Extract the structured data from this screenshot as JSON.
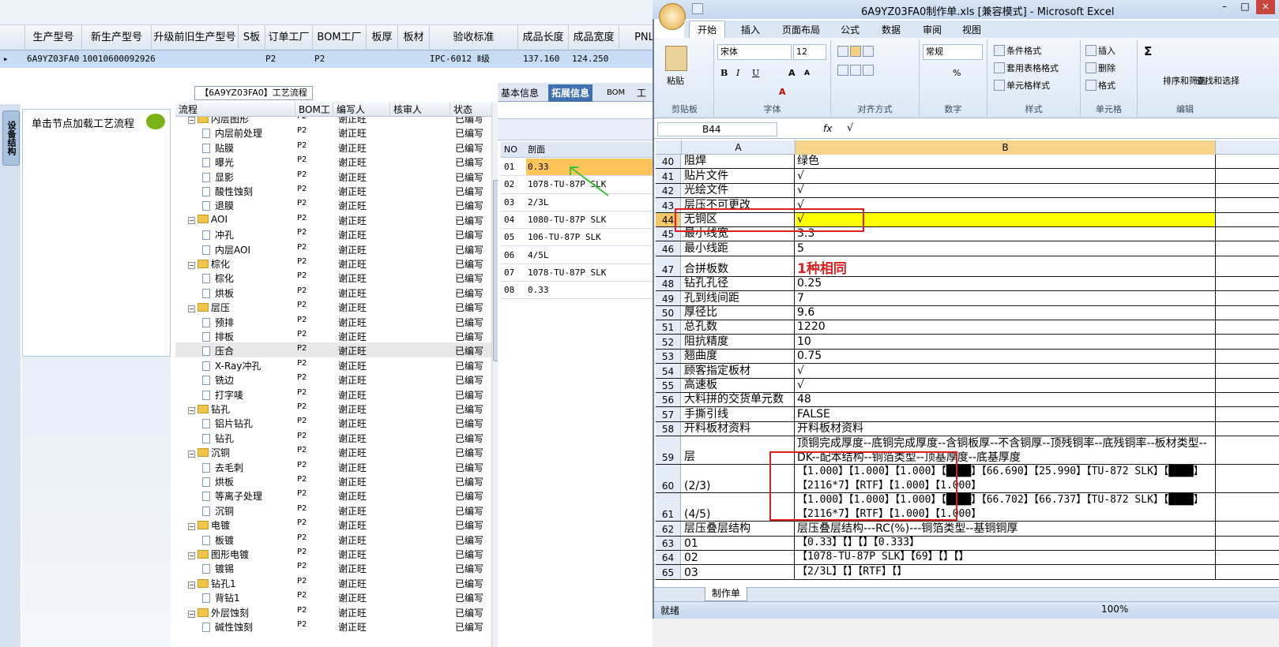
{
  "left_app": {
    "grid": {
      "headers": [
        "生产型号",
        "新生产型号",
        "升级前旧生产型号",
        "S板",
        "订单工厂",
        "BOM工厂",
        "板厚",
        "板材",
        "验收标准",
        "成品长度",
        "成品宽度",
        "PNL规"
      ],
      "row": {
        "marker": "▸",
        "model": "6A9YZ03FA0",
        "new_model": "10010600092926",
        "order_factory": "P2",
        "bom_factory": "P2",
        "standard": "IPC-6012 Ⅱ级",
        "length": "137.160",
        "width": "124.250"
      }
    },
    "flow_title": "【6A9YZ03FA0】工艺流程",
    "rail_tab": "设备结构",
    "node_hint": "单击节点加载工艺流程",
    "tree": {
      "headers": [
        "流程",
        "BOM工厂",
        "编写人",
        "核审人",
        "状态"
      ],
      "rows": [
        {
          "name": "内层图形",
          "level": 0,
          "folder": true
        },
        {
          "name": "内层前处理",
          "level": 1
        },
        {
          "name": "贴膜",
          "level": 1
        },
        {
          "name": "曝光",
          "level": 1
        },
        {
          "name": "显影",
          "level": 1
        },
        {
          "name": "酸性蚀刻",
          "level": 1
        },
        {
          "name": "退膜",
          "level": 1
        },
        {
          "name": "AOI",
          "level": 0,
          "folder": true
        },
        {
          "name": "冲孔",
          "level": 1
        },
        {
          "name": "内层AOI",
          "level": 1
        },
        {
          "name": "棕化",
          "level": 0,
          "folder": true
        },
        {
          "name": "棕化",
          "level": 1
        },
        {
          "name": "烘板",
          "level": 1
        },
        {
          "name": "层压",
          "level": 0,
          "folder": true
        },
        {
          "name": "预排",
          "level": 1
        },
        {
          "name": "排板",
          "level": 1
        },
        {
          "name": "压合",
          "level": 1,
          "selected": true
        },
        {
          "name": "X-Ray冲孔",
          "level": 1
        },
        {
          "name": "铣边",
          "level": 1
        },
        {
          "name": "打字唛",
          "level": 1
        },
        {
          "name": "钻孔",
          "level": 0,
          "folder": true
        },
        {
          "name": "铝片钻孔",
          "level": 1
        },
        {
          "name": "钻孔",
          "level": 1
        },
        {
          "name": "沉铜",
          "level": 0,
          "folder": true
        },
        {
          "name": "去毛刺",
          "level": 1
        },
        {
          "name": "烘板",
          "level": 1
        },
        {
          "name": "等离子处理",
          "level": 1
        },
        {
          "name": "沉铜",
          "level": 1
        },
        {
          "name": "电镀",
          "level": 0,
          "folder": true
        },
        {
          "name": "板镀",
          "level": 1
        },
        {
          "name": "图形电镀",
          "level": 0,
          "folder": true
        },
        {
          "name": "镀锡",
          "level": 1
        },
        {
          "name": "钻孔1",
          "level": 0,
          "folder": true
        },
        {
          "name": "背钻1",
          "level": 1
        },
        {
          "name": "外层蚀刻",
          "level": 0,
          "folder": true
        },
        {
          "name": "碱性蚀刻",
          "level": 1
        }
      ],
      "bom": "P2",
      "author": "谢正旺",
      "status": "已编写"
    },
    "tabs": [
      "基本信息",
      "拓展信息",
      "BOM",
      "工"
    ],
    "section_table": {
      "headers": [
        "NO",
        "剖面"
      ],
      "rows": [
        [
          "01",
          "0.33"
        ],
        [
          "02",
          "1078-TU-87P SLK"
        ],
        [
          "03",
          "2/3L"
        ],
        [
          "04",
          "1080-TU-87P SLK"
        ],
        [
          "05",
          "106-TU-87P SLK"
        ],
        [
          "06",
          "4/5L"
        ],
        [
          "07",
          "1078-TU-87P SLK"
        ],
        [
          "08",
          "0.33"
        ]
      ]
    }
  },
  "excel": {
    "title": "6A9YZ03FA0制作单.xls  [兼容模式] - Microsoft Excel",
    "window_controls": [
      "–",
      "□",
      "×"
    ],
    "ribbon_tabs": [
      "开始",
      "插入",
      "页面布局",
      "公式",
      "数据",
      "审阅",
      "视图"
    ],
    "font_name": "宋体",
    "font_size": "12",
    "number_format": "常规",
    "groups": [
      "剪贴板",
      "字体",
      "对齐方式",
      "数字",
      "样式",
      "单元格",
      "编辑"
    ],
    "paste_label": "粘贴",
    "style_items": [
      "条件格式",
      "套用表格格式",
      "单元格样式"
    ],
    "cell_items": [
      "插入",
      "删除",
      "格式"
    ],
    "edit_items": [
      "排序和筛选",
      "查找和选择"
    ],
    "name_box": "B44",
    "fx": "fx",
    "formula_value": "√",
    "col_a": "A",
    "col_b": "B",
    "rows": [
      {
        "n": "40",
        "a": "阻焊",
        "b": "绿色",
        "h": 18.4
      },
      {
        "n": "41",
        "a": "贴片文件",
        "b": "√",
        "h": 18.4
      },
      {
        "n": "42",
        "a": "光绘文件",
        "b": "√",
        "h": 18.4
      },
      {
        "n": "43",
        "a": "层压不可更改",
        "b": "√",
        "h": 18.4
      },
      {
        "n": "44",
        "a": "无铜区",
        "b": "√",
        "h": 18.4,
        "selected": true
      },
      {
        "n": "45",
        "a": "最小线宽",
        "b": "3.3",
        "h": 18.4
      },
      {
        "n": "46",
        "a": "最小线距",
        "b": "5",
        "h": 18.4
      },
      {
        "n": "47",
        "a": "合拼板数",
        "b": "1种相同",
        "h": 26,
        "red": true
      },
      {
        "n": "48",
        "a": "钻孔孔径",
        "b": "0.25",
        "h": 18.4
      },
      {
        "n": "49",
        "a": "孔到线间距",
        "b": "7",
        "h": 18.4
      },
      {
        "n": "50",
        "a": "厚径比",
        "b": "9.6",
        "h": 18.4
      },
      {
        "n": "51",
        "a": "总孔数",
        "b": "1220",
        "h": 18.4
      },
      {
        "n": "52",
        "a": "阻抗精度",
        "b": "10",
        "h": 18.4
      },
      {
        "n": "53",
        "a": "翘曲度",
        "b": "0.75",
        "h": 18.4
      },
      {
        "n": "54",
        "a": "顾客指定板材",
        "b": "√",
        "h": 18.4
      },
      {
        "n": "55",
        "a": "高速板",
        "b": "√",
        "h": 18.4
      },
      {
        "n": "56",
        "a": "大料拼的交货单元数",
        "b": "48",
        "h": 18.4
      },
      {
        "n": "57",
        "a": "手撕引线",
        "b": "FALSE",
        "h": 18.4
      },
      {
        "n": "58",
        "a": "开料板材资料",
        "b": "开料板材资料",
        "h": 18.4
      },
      {
        "n": "59",
        "a": "层",
        "b": "顶铜完成厚度--底铜完成厚度--含铜板厚--不含铜厚--顶残铜率--底残铜率--板材类型--DK--配本结构--铜箔类型--顶基厚度--底基厚度",
        "h": 36
      },
      {
        "n": "60",
        "a": "(2/3)",
        "b": "【1.000】【1.000】【1.000】【████】【66.690】【25.990】【TU-872 SLK】【████】【2116*7】【RTF】【1.000】【1.000】",
        "h": 36,
        "mono": true
      },
      {
        "n": "61",
        "a": "(4/5)",
        "b": "【1.000】【1.000】【1.000】【████】【66.702】【66.737】【TU-872 SLK】【████】【2116*7】【RTF】【1.000】【1.000】",
        "h": 36,
        "mono": true
      },
      {
        "n": "62",
        "a": "层压叠层结构",
        "b": "层压叠层结构---RC(%)---铜箔类型--基铜铜厚",
        "h": 18.4
      },
      {
        "n": "63",
        "a": "01",
        "b": "【0.33】【】【】【0.333】",
        "h": 18.4,
        "mono": true
      },
      {
        "n": "64",
        "a": "02",
        "b": "【1078-TU-87P SLK】【69】【】【】",
        "h": 18.4,
        "mono": true
      },
      {
        "n": "65",
        "a": "03",
        "b": "【2/3L】【】【RTF】【】",
        "h": 18.4,
        "mono": true
      }
    ],
    "sheet_tab": "制作单",
    "status": "就绪",
    "zoom": "100%"
  }
}
